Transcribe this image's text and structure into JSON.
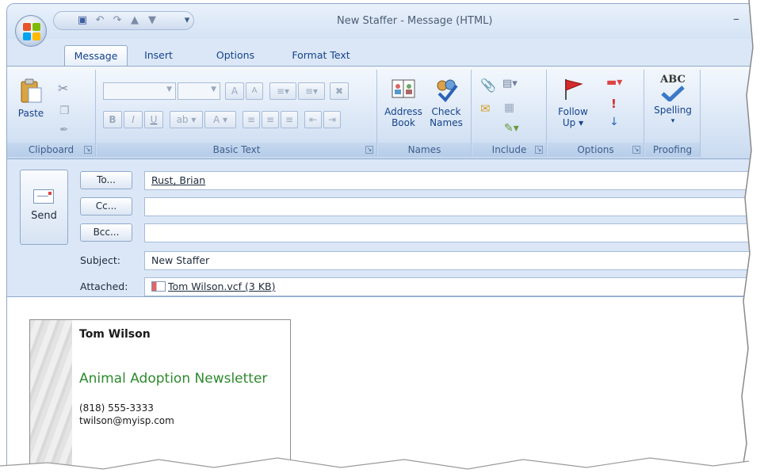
{
  "window": {
    "title": "New Staffer - Message (HTML)",
    "minimize_glyph": "–"
  },
  "quick_access": {
    "save": "save-icon",
    "undo": "undo-icon",
    "redo": "redo-icon",
    "prev": "previous-icon",
    "next": "next-icon",
    "customize_glyph": "▾"
  },
  "tabs": [
    "Message",
    "Insert",
    "Options",
    "Format Text"
  ],
  "ribbon": {
    "clipboard": {
      "paste": "Paste",
      "label": "Clipboard"
    },
    "basic_text": {
      "label": "Basic Text",
      "bold": "B",
      "italic": "I",
      "underline": "U",
      "highlight": "ab",
      "font_color": "A",
      "grow": "A",
      "shrink": "A"
    },
    "names": {
      "label": "Names",
      "address_book": [
        "Address",
        "Book"
      ],
      "check_names": [
        "Check",
        "Names"
      ]
    },
    "include": {
      "label": "Include"
    },
    "options": {
      "label": "Options",
      "follow_up": [
        "Follow",
        "Up ▾"
      ]
    },
    "proofing": {
      "label": "Proofing",
      "spelling": "Spelling",
      "abc": "ABC"
    }
  },
  "compose": {
    "send": "Send",
    "to_button": "To...",
    "cc_button": "Cc...",
    "bcc_button": "Bcc...",
    "to_value": "Rust, Brian",
    "cc_value": "",
    "bcc_value": "",
    "subject_label": "Subject:",
    "subject_value": "New Staffer",
    "attached_label": "Attached:",
    "attached_value": "Tom Wilson.vcf (3 KB)"
  },
  "business_card": {
    "name": "Tom Wilson",
    "organization": "Animal Adoption Newsletter",
    "phone": "(818) 555-3333",
    "email": "twilson@myisp.com"
  },
  "colors": {
    "ribbon_text": "#15428b",
    "org_green": "#2d8a2d",
    "frame_blue": "#dbe7f6"
  }
}
